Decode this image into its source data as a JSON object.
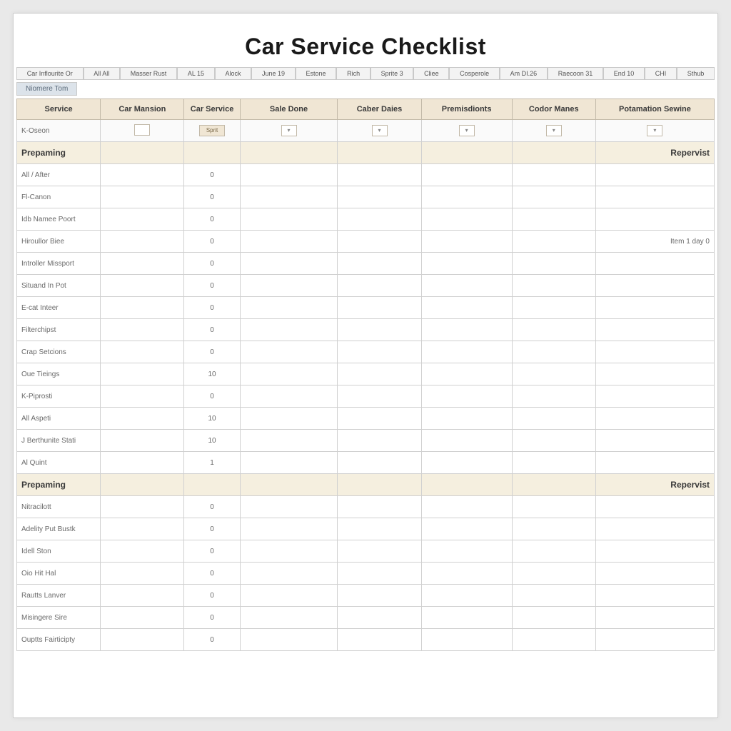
{
  "title": "Car Service Checklist",
  "toolbar": [
    "Car Inflourite Or",
    "All All",
    "Masser Rust",
    "AL 15",
    "Alock",
    "June 19",
    "Estone",
    "Rich",
    "Sprite 3",
    "Cliee",
    "Cosperole",
    "Am DI.26",
    "Raecoon 31",
    "End 10",
    "CHI",
    "Sthub"
  ],
  "subtab": "Niomere Tom",
  "columns": [
    "Service",
    "Car Mansion",
    "Car Service",
    "Sale Done",
    "Caber Daies",
    "Premisdionts",
    "Codor Manes",
    "Potamation Sewine"
  ],
  "input_row": {
    "service": "K-Oseon",
    "btn_label": "Sprit"
  },
  "sections": [
    {
      "left_label": "Prepaming",
      "right_label": "Repervist",
      "items": [
        {
          "name": "All / After",
          "cs": "0",
          "note": ""
        },
        {
          "name": "Fl-Canon",
          "cs": "0",
          "note": ""
        },
        {
          "name": "Idb Namee Poort",
          "cs": "0",
          "note": ""
        },
        {
          "name": "Hiroullor Biee",
          "cs": "0",
          "note": "Item 1 day 0"
        },
        {
          "name": "Introller Missport",
          "cs": "0",
          "note": ""
        },
        {
          "name": "Situand In Pot",
          "cs": "0",
          "note": ""
        },
        {
          "name": "E-cat Inteer",
          "cs": "0",
          "note": ""
        },
        {
          "name": "Filterchipst",
          "cs": "0",
          "note": ""
        },
        {
          "name": "Crap Setcions",
          "cs": "0",
          "note": ""
        },
        {
          "name": "Oue Tieings",
          "cs": "10",
          "note": ""
        },
        {
          "name": "K-Piprosti",
          "cs": "0",
          "note": ""
        },
        {
          "name": "All Aspeti",
          "cs": "10",
          "note": ""
        },
        {
          "name": "J Berthunite Stati",
          "cs": "10",
          "note": ""
        },
        {
          "name": "Al Quint",
          "cs": "1",
          "note": ""
        }
      ]
    },
    {
      "left_label": "Prepaming",
      "right_label": "Repervist",
      "items": [
        {
          "name": "Nitracilott",
          "cs": "0",
          "note": ""
        },
        {
          "name": "Adelity Put Bustk",
          "cs": "0",
          "note": ""
        },
        {
          "name": "Idell Ston",
          "cs": "0",
          "note": ""
        },
        {
          "name": "Oio Hit Hal",
          "cs": "0",
          "note": ""
        },
        {
          "name": "Rautts Lanver",
          "cs": "0",
          "note": ""
        },
        {
          "name": "Misingere Sire",
          "cs": "0",
          "note": ""
        },
        {
          "name": "Ouptts Fairticipty",
          "cs": "0",
          "note": "",
          "highlight": true
        }
      ]
    }
  ]
}
